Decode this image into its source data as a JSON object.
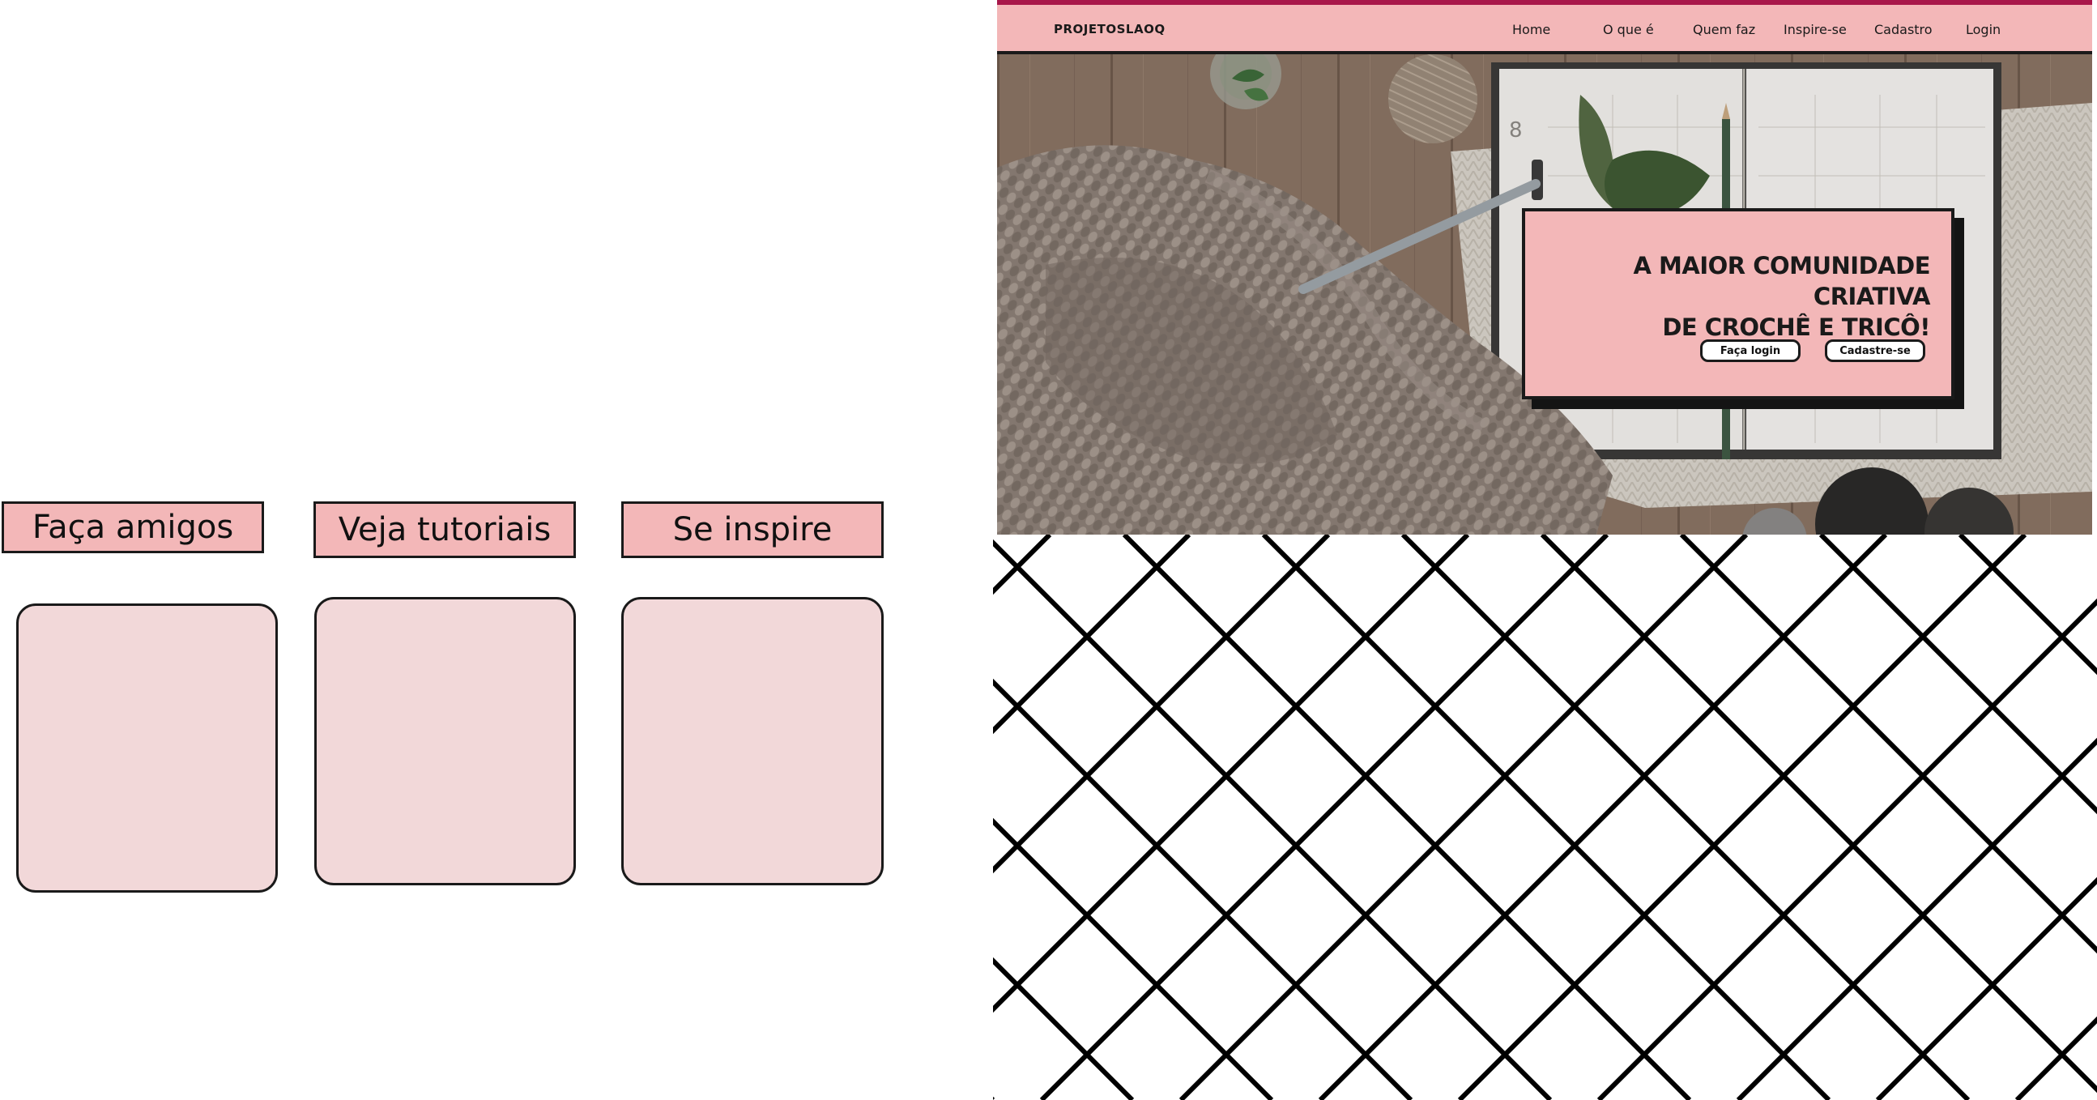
{
  "features": {
    "items": [
      {
        "label": "Faça amigos"
      },
      {
        "label": "Veja tutoriais"
      },
      {
        "label": "Se inspire"
      }
    ]
  },
  "header": {
    "brand": "PROJETOSLAOQ",
    "nav": [
      "Home",
      "O que é",
      "Quem faz",
      "Inspire-se",
      "Cadastro",
      "Login"
    ]
  },
  "hero": {
    "headline_line1": "A MAIOR COMUNIDADE CRIATIVA",
    "headline_line2": "DE CROCHÊ E TRICÔ!",
    "login_button": "Faça login",
    "signup_button": "Cadastre-se",
    "planner_day": "8"
  },
  "colors": {
    "accent_pink": "#f3b7b8",
    "card_pink": "#f2d8d9",
    "topbar_stripe": "#a8174a",
    "outline": "#1a1a1a"
  },
  "icons": {
    "hero_image": "crochet-yarn-planner-photo",
    "pattern": "diagonal-lattice-pattern"
  }
}
